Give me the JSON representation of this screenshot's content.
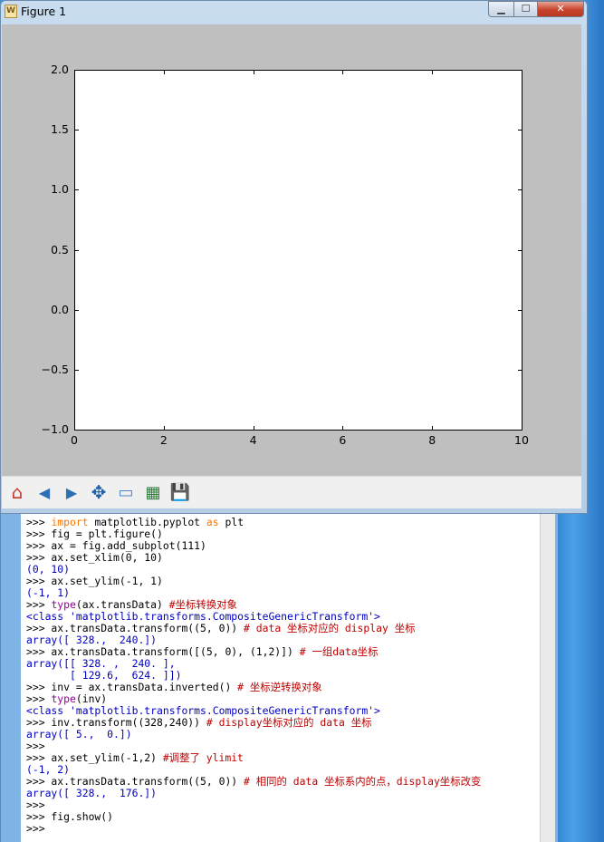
{
  "window": {
    "title": "Figure 1",
    "min_glyph": "▁",
    "max_glyph": "☐",
    "close_glyph": "✕"
  },
  "plot": {
    "xlim": [
      0,
      10
    ],
    "ylim": [
      -1.0,
      2.0
    ],
    "x_ticks": [
      "0",
      "2",
      "4",
      "6",
      "8",
      "10"
    ],
    "y_ticks": [
      "2.0",
      "1.5",
      "1.0",
      "0.5",
      "0.0",
      "−0.5",
      "−1.0"
    ]
  },
  "toolbar": {
    "home_glyph": "⌂",
    "back_glyph": "◀",
    "forward_glyph": "▶",
    "pan_glyph": "✥",
    "zoom_glyph": "▭",
    "subplots_glyph": "▦",
    "save_glyph": "💾"
  },
  "console": {
    "lines": [
      [
        {
          "t": ">>> ",
          "c": "p"
        },
        {
          "t": "import",
          "c": "kw"
        },
        {
          "t": " matplotlib.pyplot ",
          "c": "p"
        },
        {
          "t": "as",
          "c": "kw"
        },
        {
          "t": " plt",
          "c": "p"
        }
      ],
      [
        {
          "t": ">>> fig = plt.figure()",
          "c": "p"
        }
      ],
      [
        {
          "t": ">>> ax = fig.add_subplot(111)",
          "c": "p"
        }
      ],
      [
        {
          "t": ">>> ax.set_xlim(0, 10)",
          "c": "p"
        }
      ],
      [
        {
          "t": "(0, 10)",
          "c": "out"
        }
      ],
      [
        {
          "t": ">>> ax.set_ylim(-1, 1)",
          "c": "p"
        }
      ],
      [
        {
          "t": "(-1, 1)",
          "c": "out"
        }
      ],
      [
        {
          "t": ">>> ",
          "c": "p"
        },
        {
          "t": "type",
          "c": "kw2"
        },
        {
          "t": "(ax.transData) ",
          "c": "p"
        },
        {
          "t": "#坐标转换对象",
          "c": "cm"
        }
      ],
      [
        {
          "t": "<class 'matplotlib.transforms.CompositeGenericTransform'>",
          "c": "cls"
        }
      ],
      [
        {
          "t": ">>> ax.transData.transform((5, 0)) ",
          "c": "p"
        },
        {
          "t": "# data 坐标对应的 display 坐标",
          "c": "cm"
        }
      ],
      [
        {
          "t": "array([ 328.,  240.])",
          "c": "out"
        }
      ],
      [
        {
          "t": ">>> ax.transData.transform([(5, 0), (1,2)]) ",
          "c": "p"
        },
        {
          "t": "# 一组data坐标",
          "c": "cm"
        }
      ],
      [
        {
          "t": "array([[ 328. ,  240. ],",
          "c": "out"
        }
      ],
      [
        {
          "t": "       [ 129.6,  624. ]])",
          "c": "out"
        }
      ],
      [
        {
          "t": ">>> inv = ax.transData.inverted() ",
          "c": "p"
        },
        {
          "t": "# 坐标逆转换对象",
          "c": "cm"
        }
      ],
      [
        {
          "t": ">>> ",
          "c": "p"
        },
        {
          "t": "type",
          "c": "kw2"
        },
        {
          "t": "(inv)",
          "c": "p"
        }
      ],
      [
        {
          "t": "<class 'matplotlib.transforms.CompositeGenericTransform'>",
          "c": "cls"
        }
      ],
      [
        {
          "t": ">>> inv.transform((328,240)) ",
          "c": "p"
        },
        {
          "t": "# display坐标对应的 data 坐标",
          "c": "cm"
        }
      ],
      [
        {
          "t": "array([ 5.,  0.])",
          "c": "out"
        }
      ],
      [
        {
          "t": ">>>",
          "c": "p"
        }
      ],
      [
        {
          "t": ">>> ax.set_ylim(-1,2) ",
          "c": "p"
        },
        {
          "t": "#调整了 ylimit",
          "c": "cm"
        }
      ],
      [
        {
          "t": "(-1, 2)",
          "c": "out"
        }
      ],
      [
        {
          "t": ">>> ax.transData.transform((5, 0)) ",
          "c": "p"
        },
        {
          "t": "# 相同的 data 坐标系内的点，display坐标改变",
          "c": "cm"
        }
      ],
      [
        {
          "t": "array([ 328.,  176.])",
          "c": "out"
        }
      ],
      [
        {
          "t": ">>>",
          "c": "p"
        }
      ],
      [
        {
          "t": ">>> fig.show()",
          "c": "p"
        }
      ],
      [
        {
          "t": ">>>",
          "c": "p"
        }
      ]
    ]
  }
}
